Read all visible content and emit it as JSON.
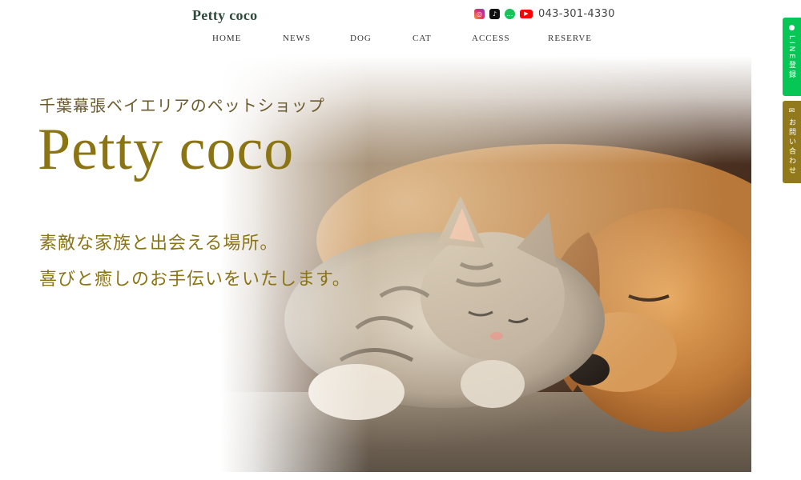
{
  "header": {
    "logo": "Petty coco",
    "phone": "043-301-4330",
    "social": [
      {
        "name": "instagram-icon",
        "glyph": "◎"
      },
      {
        "name": "tiktok-icon",
        "glyph": "♪"
      },
      {
        "name": "line-icon",
        "glyph": "…"
      },
      {
        "name": "youtube-icon",
        "glyph": "▶"
      }
    ]
  },
  "nav": {
    "home": "HOME",
    "news": "NEWS",
    "dog": "DOG",
    "cat": "CAT",
    "access": "ACCESS",
    "reserve": "RESERVE"
  },
  "hero": {
    "tagline": "千葉幕張ベイエリアのペットショップ",
    "title": "Petty coco",
    "catch_line1": "素敵な家族と出会える場所。",
    "catch_line2": "喜びと癒しのお手伝いをいたします。"
  },
  "side": {
    "line_label": "LINE登録",
    "contact_label": "お問い合わせ"
  },
  "colors": {
    "accent_gold": "#8a7414",
    "logo_green": "#2e4a3a",
    "line_green": "#06c755",
    "contact_gold": "#927a1c"
  }
}
